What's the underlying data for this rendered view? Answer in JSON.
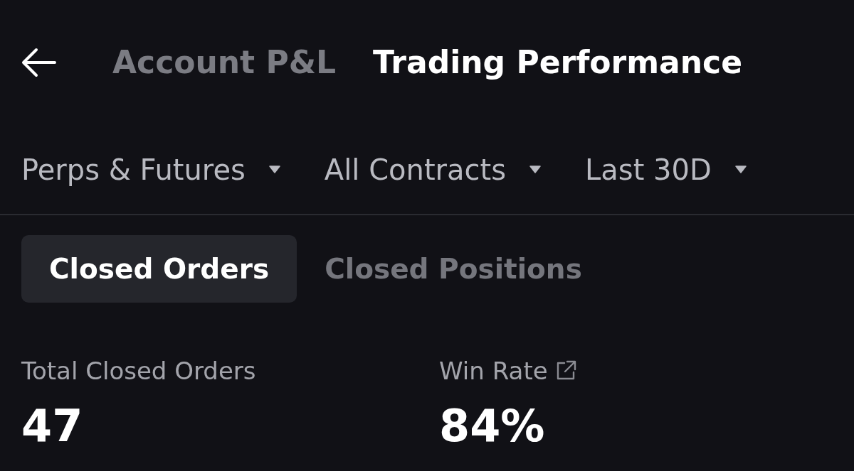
{
  "header": {
    "tabs": [
      {
        "label": "Account P&L",
        "selected": false
      },
      {
        "label": "Trading Performance",
        "selected": true
      }
    ]
  },
  "filters": [
    {
      "label": "Perps & Futures"
    },
    {
      "label": "All Contracts"
    },
    {
      "label": "Last 30D"
    }
  ],
  "segments": [
    {
      "label": "Closed Orders",
      "selected": true
    },
    {
      "label": "Closed Positions",
      "selected": false
    }
  ],
  "stats": [
    {
      "label": "Total Closed Orders",
      "value": "47",
      "link": false
    },
    {
      "label": "Win Rate",
      "value": "84%",
      "link": true
    }
  ]
}
